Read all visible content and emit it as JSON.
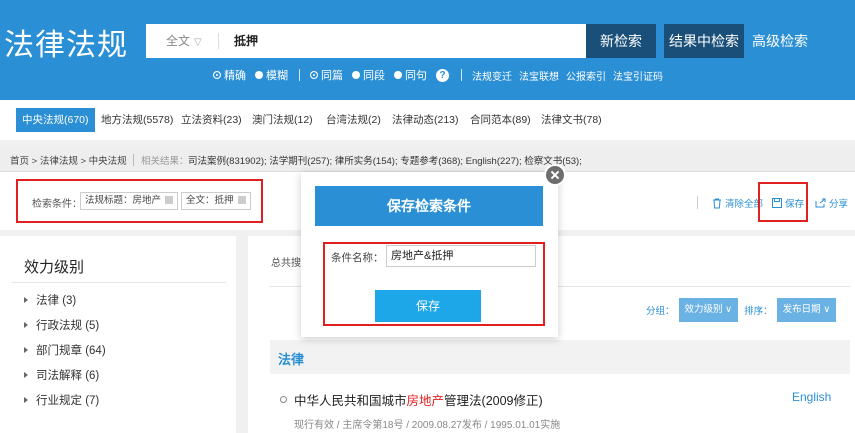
{
  "header": {
    "logo": "法律法规",
    "scope": "全文",
    "query": "抵押",
    "btn_new": "新检索",
    "btn_within": "结果中检索",
    "btn_advanced": "高级检索",
    "match_options": [
      "精确",
      "模糊"
    ],
    "scope_options": [
      "同篇",
      "同段",
      "同句"
    ],
    "help": "?",
    "tools": [
      "法规变迁",
      "法宝联想",
      "公报索引",
      "法宝引证码"
    ]
  },
  "tabs": [
    {
      "label": "中央法规(670)",
      "active": true
    },
    {
      "label": "地方法规(5578)"
    },
    {
      "label": "立法资料(23)"
    },
    {
      "label": "澳门法规(12)"
    },
    {
      "label": "台湾法规(2)"
    },
    {
      "label": "法律动态(213)"
    },
    {
      "label": "合同范本(89)"
    },
    {
      "label": "法律文书(78)"
    }
  ],
  "breadcrumb": {
    "path": "首页 > 法律法规 > 中央法规",
    "related_label": "相关结果：",
    "related": "司法案例(831902); 法学期刊(257); 律所实务(154); 专题参考(368); English(227); 检察文书(53);"
  },
  "conditions": {
    "label": "检索条件：",
    "chips": [
      "法规标题：房地产",
      "全文：抵押"
    ],
    "clear_all": "清除全部",
    "save": "保存",
    "share": "分享"
  },
  "sidebar": {
    "title": "效力级别",
    "items": [
      "法律 (3)",
      "行政法规 (5)",
      "部门规章 (64)",
      "司法解释 (6)",
      "行业规定 (7)"
    ]
  },
  "main": {
    "total": "总共搜",
    "group_label": "分组：",
    "group_value": "效力级别",
    "sort_label": "排序：",
    "sort_value": "发布日期",
    "category_title": "法律",
    "result": {
      "title_pre": "中华人民共和国城市",
      "title_hl": "房地产",
      "title_post": "管理法(2009修正)",
      "english": "English",
      "meta": "现行有效 / 主席令第18号 / 2009.08.27发布 / 1995.01.01实施"
    }
  },
  "modal": {
    "title": "保存检索条件",
    "field_label": "条件名称：",
    "field_value": "房地产&抵押",
    "save_button": "保存"
  }
}
